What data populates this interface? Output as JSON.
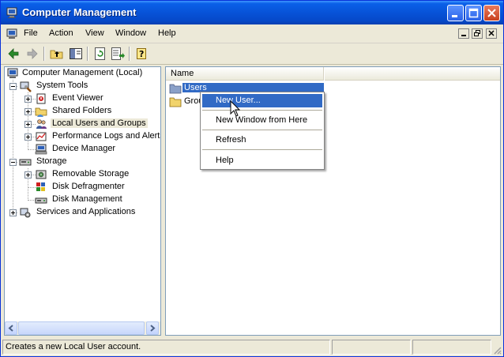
{
  "window": {
    "title": "Computer Management"
  },
  "menubar": {
    "items": [
      "File",
      "Action",
      "View",
      "Window",
      "Help"
    ]
  },
  "toolbar": {
    "icons": [
      "back-arrow-icon",
      "forward-arrow-icon",
      "up-folder-icon",
      "show-hide-tree-icon",
      "refresh-icon",
      "export-list-icon",
      "help-icon"
    ]
  },
  "tree": {
    "root": "Computer Management (Local)",
    "system_tools": "System Tools",
    "event_viewer": "Event Viewer",
    "shared_folders": "Shared Folders",
    "local_users": "Local Users and Groups",
    "perf_logs": "Performance Logs and Alerts",
    "device_manager": "Device Manager",
    "storage": "Storage",
    "removable_storage": "Removable Storage",
    "disk_defrag": "Disk Defragmenter",
    "disk_mgmt": "Disk Management",
    "services": "Services and Applications"
  },
  "list": {
    "column_name": "Name",
    "items": [
      "Users",
      "Groups"
    ]
  },
  "context_menu": {
    "new_user": "New User...",
    "new_window": "New Window from Here",
    "refresh": "Refresh",
    "help": "Help"
  },
  "status": {
    "text": "Creates a new Local User account."
  },
  "colors": {
    "titlebar": "#0753d8",
    "selection": "#316ac5",
    "frame": "#ece9d8"
  }
}
